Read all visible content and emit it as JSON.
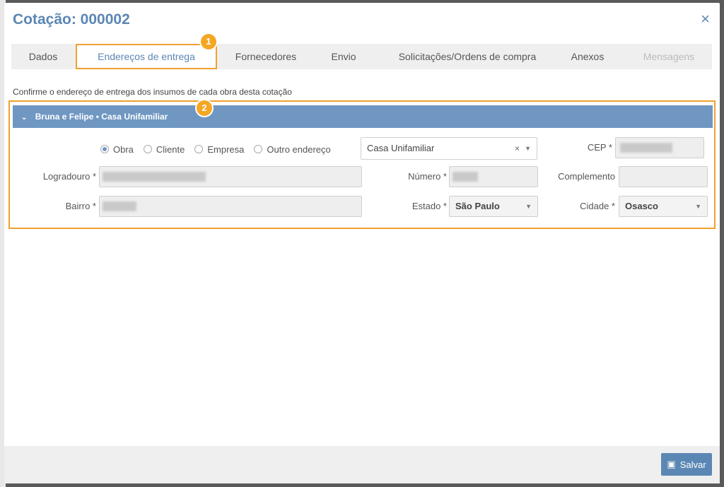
{
  "modal": {
    "title": "Cotação: 000002",
    "close_icon": "×"
  },
  "tabs": [
    {
      "label": "Dados"
    },
    {
      "label": "Endereços de entrega"
    },
    {
      "label": "Fornecedores"
    },
    {
      "label": "Envio"
    },
    {
      "label": "Solicitações/Ordens de compra"
    },
    {
      "label": "Anexos"
    },
    {
      "label": "Mensagens"
    }
  ],
  "badges": [
    "1",
    "2"
  ],
  "instruction": "Confirme o endereço de entrega dos insumos de cada obra desta cotação",
  "section": {
    "title": "Bruna e Felipe • Casa Unifamiliar",
    "address_type": {
      "options": [
        "Obra",
        "Cliente",
        "Empresa",
        "Outro endereço"
      ],
      "selected": "Obra"
    },
    "obra_select": "Casa Unifamiliar",
    "labels": {
      "cep": "CEP *",
      "logradouro": "Logradouro *",
      "numero": "Número *",
      "complemento": "Complemento",
      "bairro": "Bairro *",
      "estado": "Estado *",
      "cidade": "Cidade *"
    },
    "estado": "São Paulo",
    "cidade": "Osasco"
  },
  "footer": {
    "save_label": "Salvar"
  },
  "colors": {
    "accent": "#5b87b4",
    "highlight": "#f0a030",
    "header_bg": "#6f97c2"
  }
}
